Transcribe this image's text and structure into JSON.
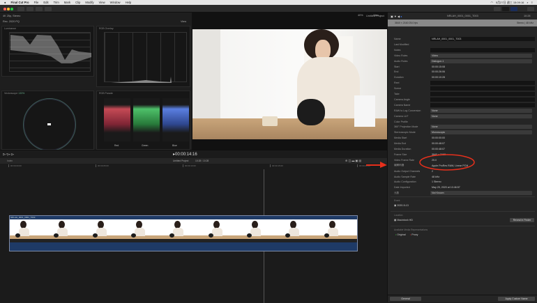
{
  "menubar": {
    "app": "Final Cut Pro",
    "items": [
      "File",
      "Edit",
      "Trim",
      "Mark",
      "Clip",
      "Modify",
      "View",
      "Window",
      "Help"
    ],
    "clock": "5月27日 週三 15:09:16"
  },
  "scopes": {
    "format": "4K 25p, Stereo",
    "colorspace": "Rec. 2020 PQ",
    "view_label": "View",
    "luminance": "Luminance",
    "rgb_overlay": "RGB Overlay",
    "vectorscope": "Vectorscope",
    "vectorscope_pct": "133%",
    "rgb_parade": "RGB Parade",
    "parade_labels": [
      "Red",
      "Green",
      "Blue"
    ],
    "overlay_ticks": [
      "-20",
      "0",
      "25",
      "50",
      "75",
      "100",
      "120"
    ],
    "lum_ticks": [
      "10K",
      "5K",
      "2K",
      "1K",
      "500",
      "100",
      "50",
      "20",
      "10",
      "0"
    ]
  },
  "viewer": {
    "project": "Untitled Project",
    "zoom": "40%",
    "view": "View"
  },
  "inspector": {
    "clip_name": "NRLAH_0001_0001_T003",
    "duration": "10:28",
    "format_line": "3840 × 2160  25.0 fps",
    "audio_line": "Stereo | 48 kHz",
    "rows": [
      {
        "k": "Name",
        "v": "NRLAH_0001_0001_T003",
        "t": "box"
      },
      {
        "k": "Last Modified",
        "v": "",
        "t": "none"
      },
      {
        "k": "Notes",
        "v": "",
        "t": "box"
      },
      {
        "k": "Video Roles",
        "v": "Video",
        "t": "pop"
      },
      {
        "k": "Audio Roles",
        "v": "Dialogue-1",
        "t": "pop"
      },
      {
        "k": "Start",
        "v": "00:00:15:08",
        "t": "text"
      },
      {
        "k": "End",
        "v": "00:00:26:06",
        "t": "text"
      },
      {
        "k": "Duration",
        "v": "00:00:10:28",
        "t": "text"
      },
      {
        "k": "Reel",
        "v": "",
        "t": "box"
      },
      {
        "k": "Scene",
        "v": "",
        "t": "box"
      },
      {
        "k": "Take",
        "v": "",
        "t": "box"
      },
      {
        "k": "Camera Angle",
        "v": "",
        "t": "box"
      },
      {
        "k": "Camera Name",
        "v": "",
        "t": "box"
      },
      {
        "k": "RAW to Log Conversion",
        "v": "None",
        "t": "pop"
      },
      {
        "k": "Camera LUT",
        "v": "None",
        "t": "pop"
      },
      {
        "k": "Color Profile",
        "v": "",
        "t": "none"
      },
      {
        "k": "360° Projection Mode",
        "v": "None",
        "t": "pop"
      },
      {
        "k": "Stereoscopic Mode",
        "v": "Monoscopic",
        "t": "pop"
      },
      {
        "k": "Media Start",
        "v": "00:00:00:00",
        "t": "text"
      },
      {
        "k": "Media End",
        "v": "00:00:48:07",
        "t": "text"
      },
      {
        "k": "Media Duration",
        "v": "00:00:48:07",
        "t": "text"
      },
      {
        "k": "Frame Size",
        "v": "3840 × 2160",
        "t": "text"
      },
      {
        "k": "Video Frame Rate",
        "v": "25.0",
        "t": "text"
      },
      {
        "k": "编解码器",
        "v": "Apple ProRes RAW, Linear PCM",
        "t": "text"
      },
      {
        "k": "Audio Output Channels",
        "v": "2",
        "t": "text"
      },
      {
        "k": "Audio Sample Rate",
        "v": "48 kHz",
        "t": "text"
      },
      {
        "k": "Audio Configuration",
        "v": "1 Stereo",
        "t": "text"
      },
      {
        "k": "Date Imported",
        "v": "May 25, 2020 at 10:46:57",
        "t": "text"
      },
      {
        "k": "元数",
        "v": "Not Known",
        "t": "pop"
      }
    ],
    "event_label": "Event",
    "event": "2020-5-13",
    "location_label": "Location",
    "location": "Macintosh HD",
    "reveal": "Reveal in Finder",
    "media_label": "Available Media Representations",
    "original": "Original",
    "proxy": "Proxy",
    "general": "General",
    "apply": "Apply Custom Name"
  },
  "timeline": {
    "timecode": "00:00:14:16",
    "index": "Index",
    "project": "Untitled Project",
    "project_time": "10:28 / 10:28",
    "clip_label": "NRLAH_0001_0001_T003",
    "ruler": [
      "00:00:00:00",
      "00:00:05:00",
      "00:00:10:00",
      "00:00:15:00",
      "00:00:20:00"
    ]
  },
  "colors": {
    "accent": "#3d6fd9",
    "annotation": "#e8301c",
    "clip_audio": "#1e3a66"
  }
}
